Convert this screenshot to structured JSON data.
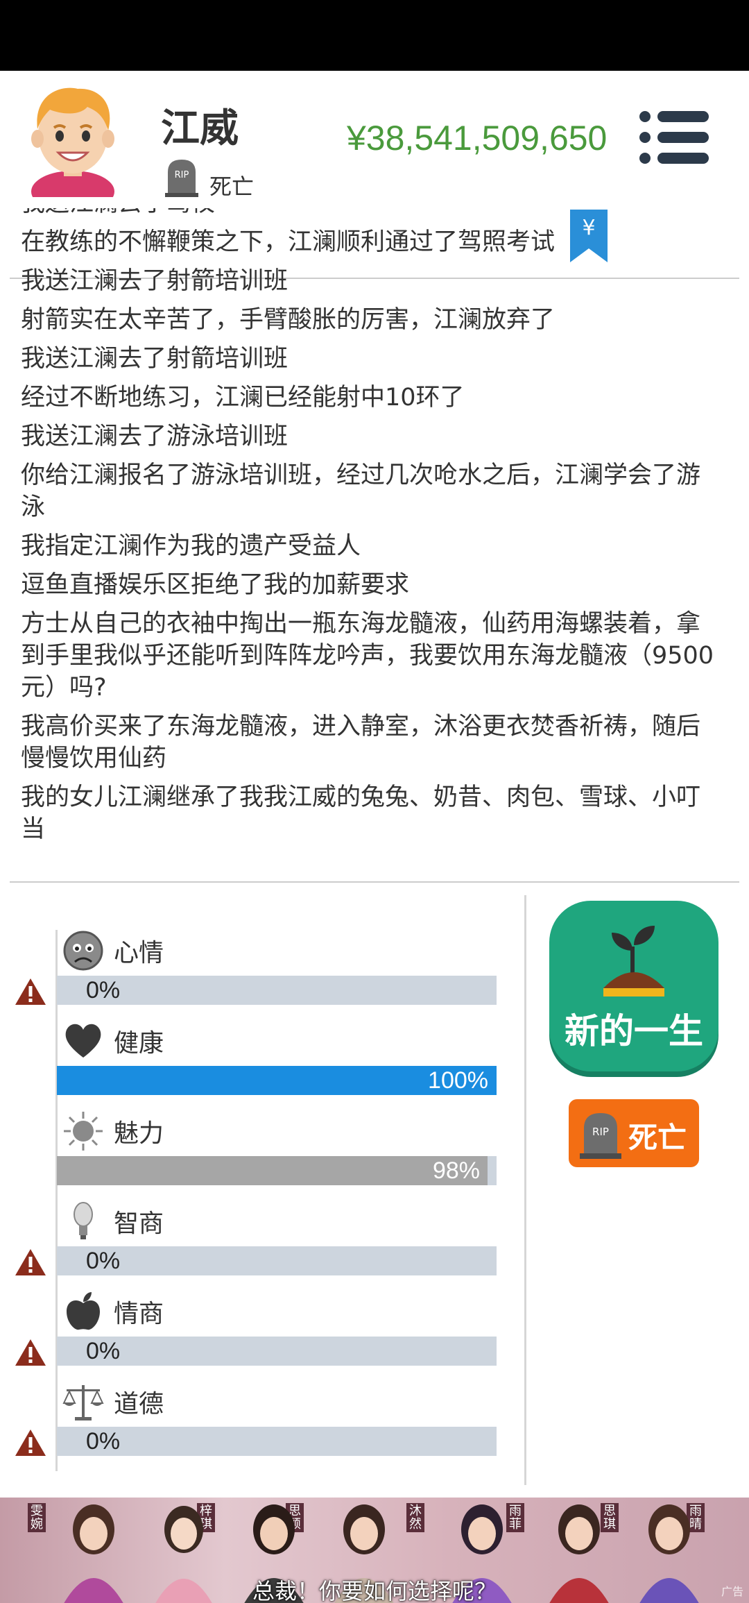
{
  "header": {
    "name": "江威",
    "status": "死亡",
    "money": "¥38,541,509,650"
  },
  "log": [
    "我送江澜去了驾校",
    "在教练的不懈鞭策之下，江澜顺利通过了驾照考试",
    "我送江澜去了射箭培训班",
    "射箭实在太辛苦了，手臂酸胀的厉害，江澜放弃了",
    "我送江澜去了射箭培训班",
    "经过不断地练习，江澜已经能射中10环了",
    "我送江澜去了游泳培训班",
    "你给江澜报名了游泳培训班，经过几次呛水之后，江澜学会了游泳",
    "我指定江澜作为我的遗产受益人",
    "逗鱼直播娱乐区拒绝了我的加薪要求",
    "方士从自己的衣袖中掏出一瓶东海龙髓液，仙药用海螺装着，拿到手里我似乎还能听到阵阵龙吟声，我要饮用东海龙髓液（9500元）吗?",
    "我高价买来了东海龙髓液，进入静室，沐浴更衣焚香祈祷，随后慢慢饮用仙药",
    "我的女儿江澜继承了我我江威的兔兔、奶昔、肉包、雪球、小叮当"
  ],
  "bookmark_symbol": "¥",
  "stats": [
    {
      "key": "mood",
      "label": "心情",
      "value": 0,
      "text": "0%",
      "icon": "sad-face-icon",
      "warning": true
    },
    {
      "key": "health",
      "label": "健康",
      "value": 100,
      "text": "100%",
      "icon": "heart-icon",
      "warning": false,
      "color": "#1a8de0"
    },
    {
      "key": "charm",
      "label": "魅力",
      "value": 98,
      "text": "98%",
      "icon": "sun-icon",
      "warning": false,
      "color": "#a6a6a6"
    },
    {
      "key": "iq",
      "label": "智商",
      "value": 0,
      "text": "0%",
      "icon": "light-bulb-icon",
      "warning": true
    },
    {
      "key": "eq",
      "label": "情商",
      "value": 0,
      "text": "0%",
      "icon": "apple-icon",
      "warning": true
    },
    {
      "key": "morality",
      "label": "道德",
      "value": 0,
      "text": "0%",
      "icon": "scales-icon",
      "warning": true
    }
  ],
  "actions": {
    "new_life": "新的一生",
    "death": "死亡"
  },
  "ad": {
    "caption": "总裁！你要如何选择呢？",
    "tags": [
      "雯婉",
      "梓琪",
      "思颖",
      "沐然",
      "雨菲",
      "思琪",
      "雨晴"
    ],
    "corner": "广告"
  }
}
